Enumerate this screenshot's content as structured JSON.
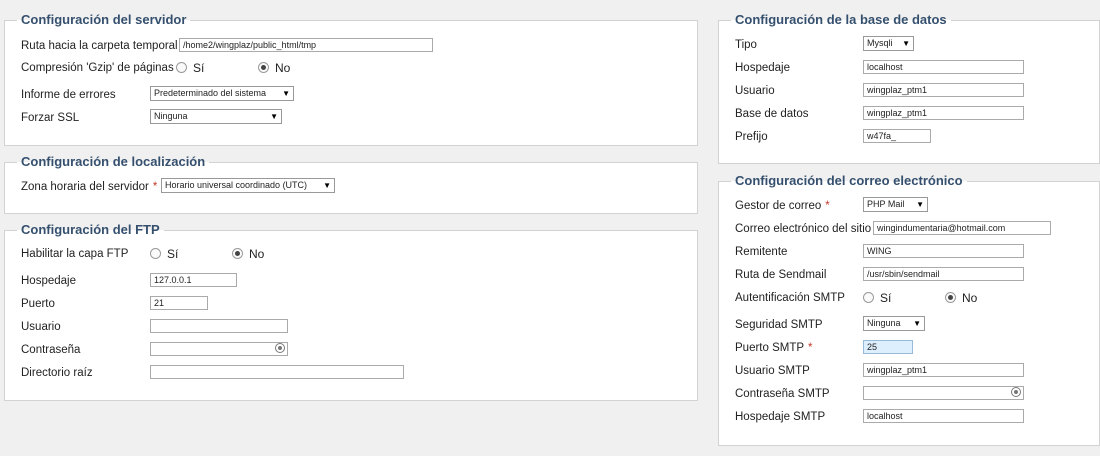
{
  "servidor": {
    "title": "Configuración del servidor",
    "tmp_label": "Ruta hacia la carpeta temporal",
    "tmp_value": "/home2/wingplaz/public_html/tmp",
    "gzip_label": "Compresión 'Gzip' de páginas",
    "yes": "Sí",
    "no": "No",
    "gzip_selected": "No",
    "errores_label": "Informe de errores",
    "errores_value": "Predeterminado del sistema",
    "ssl_label": "Forzar SSL",
    "ssl_value": "Ninguna"
  },
  "localizacion": {
    "title": "Configuración de localización",
    "zona_label": "Zona horaria del servidor",
    "required_mark": "*",
    "zona_value": "Horario universal coordinado (UTC)"
  },
  "ftp": {
    "title": "Configuración del FTP",
    "capa_label": "Habilitar la capa FTP",
    "yes": "Sí",
    "no": "No",
    "capa_selected": "No",
    "host_label": "Hospedaje",
    "host_value": "127.0.0.1",
    "port_label": "Puerto",
    "port_value": "21",
    "user_label": "Usuario",
    "user_value": "",
    "pass_label": "Contraseña",
    "pass_value": "",
    "root_label": "Directorio raíz",
    "root_value": ""
  },
  "bd": {
    "title": "Configuración de la base de datos",
    "tipo_label": "Tipo",
    "tipo_value": "Mysqli",
    "host_label": "Hospedaje",
    "host_value": "localhost",
    "user_label": "Usuario",
    "user_value": "wingplaz_ptm1",
    "db_label": "Base de datos",
    "db_value": "wingplaz_ptm1",
    "prefix_label": "Prefijo",
    "prefix_value": "w47fa_"
  },
  "correo": {
    "title": "Configuración del correo electrónico",
    "gestor_label": "Gestor de correo",
    "required_mark": "*",
    "gestor_value": "PHP Mail",
    "email_label": "Correo electrónico del sitio",
    "email_value": "wingindumentaria@hotmail.com",
    "from_label": "Remitente",
    "from_value": "WING",
    "sendmail_label": "Ruta de Sendmail",
    "sendmail_value": "/usr/sbin/sendmail",
    "auth_label": "Autentificación SMTP",
    "yes": "Sí",
    "no": "No",
    "auth_selected": "No",
    "sec_label": "Seguridad SMTP",
    "sec_value": "Ninguna",
    "port_label": "Puerto SMTP",
    "port_value": "25",
    "smtp_user_label": "Usuario SMTP",
    "smtp_user_value": "wingplaz_ptm1",
    "smtp_pass_label": "Contraseña SMTP",
    "smtp_pass_value": "",
    "smtp_host_label": "Hospedaje SMTP",
    "smtp_host_value": "localhost"
  }
}
